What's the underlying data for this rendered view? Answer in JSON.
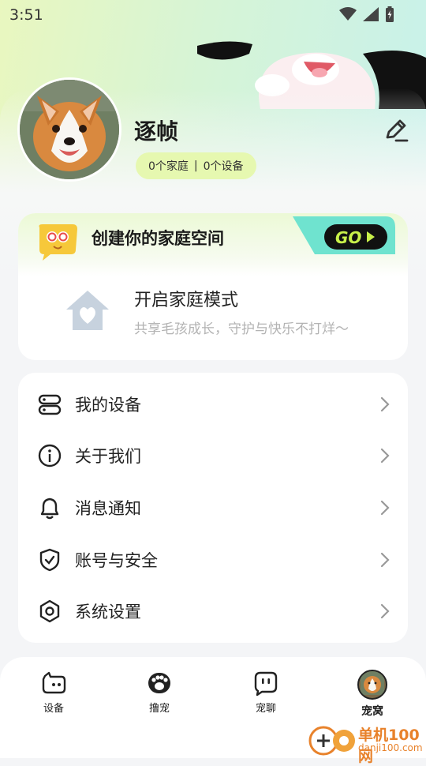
{
  "status_bar": {
    "time": "3:51"
  },
  "profile": {
    "name": "逐帧",
    "family_count": "0个家庭",
    "device_count": "0个设备"
  },
  "family_card": {
    "banner_title": "创建你的家庭空间",
    "go_label": "GO",
    "mode_title": "开启家庭模式",
    "mode_subtitle": "共享毛孩成长，守护与快乐不打烊～"
  },
  "menu": {
    "items": [
      {
        "label": "我的设备",
        "icon": "devices-icon"
      },
      {
        "label": "关于我们",
        "icon": "info-icon"
      },
      {
        "label": "消息通知",
        "icon": "bell-icon"
      },
      {
        "label": "账号与安全",
        "icon": "shield-icon"
      },
      {
        "label": "系统设置",
        "icon": "hexagon-settings-icon"
      }
    ]
  },
  "bottom_nav": {
    "items": [
      {
        "label": "设备",
        "icon": "device-cat-icon"
      },
      {
        "label": "撸宠",
        "icon": "paw-icon"
      },
      {
        "label": "宠聊",
        "icon": "chat-bubble-icon"
      },
      {
        "label": "宠窝",
        "icon": "avatar-icon",
        "active": true
      }
    ]
  },
  "watermark": {
    "title": "单机100网",
    "subtitle": "danji100.com"
  },
  "colors": {
    "accent_lime": "#e6f8b0",
    "go_bg": "#6fe3cf",
    "text_dark": "#1a1a1a",
    "muted": "#b3b3b3"
  }
}
